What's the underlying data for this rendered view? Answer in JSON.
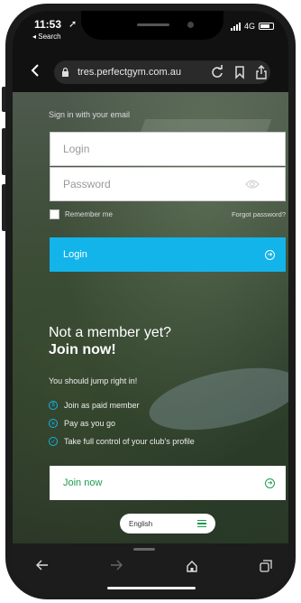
{
  "status_bar": {
    "time": "11:53",
    "back_app": "◂ Search",
    "network": "4G"
  },
  "browser": {
    "url": "tres.perfectgym.com.au"
  },
  "login_form": {
    "heading": "Sign in with your email",
    "login_placeholder": "Login",
    "password_placeholder": "Password",
    "remember_label": "Remember me",
    "forgot_label": "Forgot password?",
    "login_button": "Login"
  },
  "promo": {
    "title": "Not a member yet?",
    "subtitle": "Join now!",
    "intro": "You should jump right in!",
    "benefits": [
      {
        "label": "Join as paid member",
        "icon": "dollar-circle-icon"
      },
      {
        "label": "Pay as you go",
        "icon": "x-circle-icon"
      },
      {
        "label": "Take full control of your club's profile",
        "icon": "check-circle-icon"
      }
    ],
    "join_button": "Join now"
  },
  "language_selector": {
    "value": "English"
  },
  "colors": {
    "accent_blue": "#12b4ea",
    "accent_green": "#1e9a4e"
  }
}
